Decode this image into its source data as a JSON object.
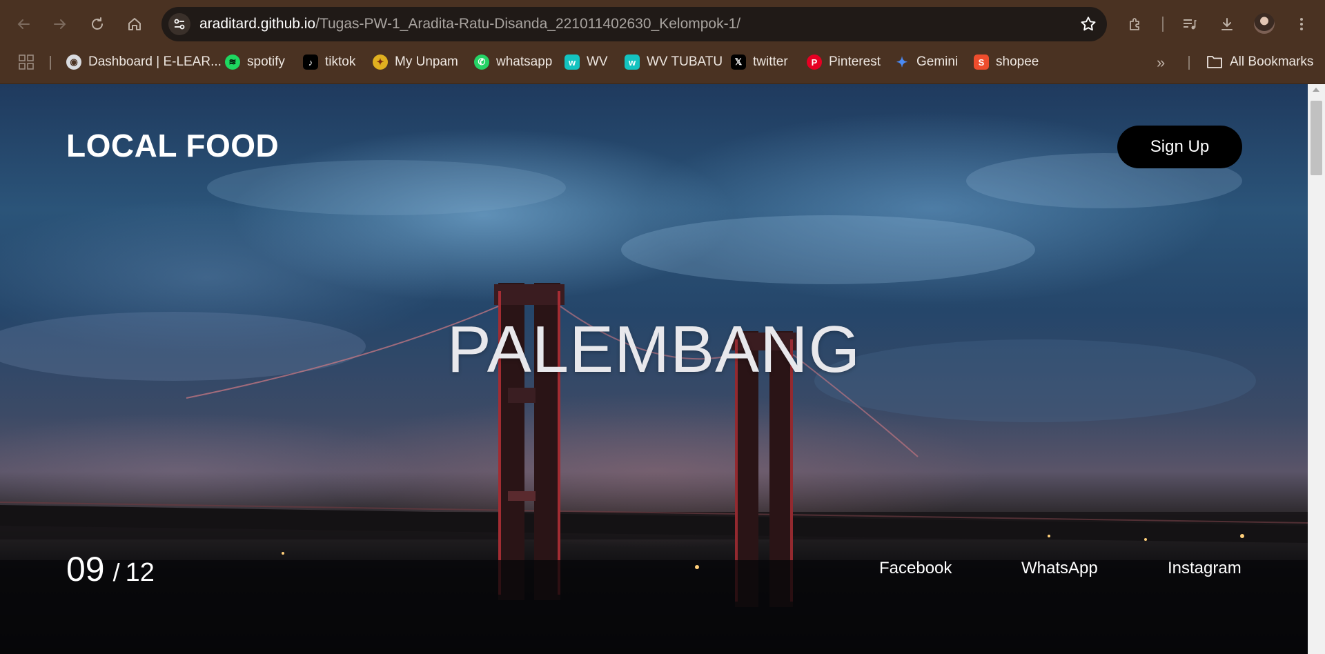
{
  "browser": {
    "url_host": "araditard.github.io",
    "url_path": "/Tugas-PW-1_Aradita-Ratu-Disanda_221011402630_Kelompok-1/",
    "bookmarks": [
      {
        "label": "Dashboard | E-LEAR...",
        "icon": "globe-icon",
        "color": "#5f6368"
      },
      {
        "label": "spotify",
        "icon": "spotify-icon",
        "color": "#1ed760"
      },
      {
        "label": "tiktok",
        "icon": "tiktok-icon",
        "color": "#000000"
      },
      {
        "label": "My Unpam",
        "icon": "unpam-icon",
        "color": "#e0b020"
      },
      {
        "label": "whatsapp",
        "icon": "whatsapp-icon",
        "color": "#25d366"
      },
      {
        "label": "WV",
        "icon": "wv-icon",
        "color": "#14c3c0"
      },
      {
        "label": "WV TUBATU",
        "icon": "wv-icon",
        "color": "#14c3c0"
      },
      {
        "label": "twitter",
        "icon": "x-icon",
        "color": "#000000"
      },
      {
        "label": "Pinterest",
        "icon": "pinterest-icon",
        "color": "#e60023"
      },
      {
        "label": "Gemini",
        "icon": "gemini-icon",
        "color": "#4a8af4"
      },
      {
        "label": "shopee",
        "icon": "shopee-icon",
        "color": "#ee4d2d"
      }
    ],
    "all_bookmarks_label": "All Bookmarks",
    "more_bookmarks_glyph": "»"
  },
  "page": {
    "logo": "LOCAL FOOD",
    "signup_label": "Sign Up",
    "hero_title": "PALEMBANG",
    "counter_current": "09",
    "counter_separator": "/",
    "counter_total": "12",
    "social": {
      "facebook": "Facebook",
      "whatsapp": "WhatsApp",
      "instagram": "Instagram"
    }
  },
  "colors": {
    "toolbar": "#4a3222",
    "omnibox": "#201a17",
    "signup_bg": "#000000"
  }
}
